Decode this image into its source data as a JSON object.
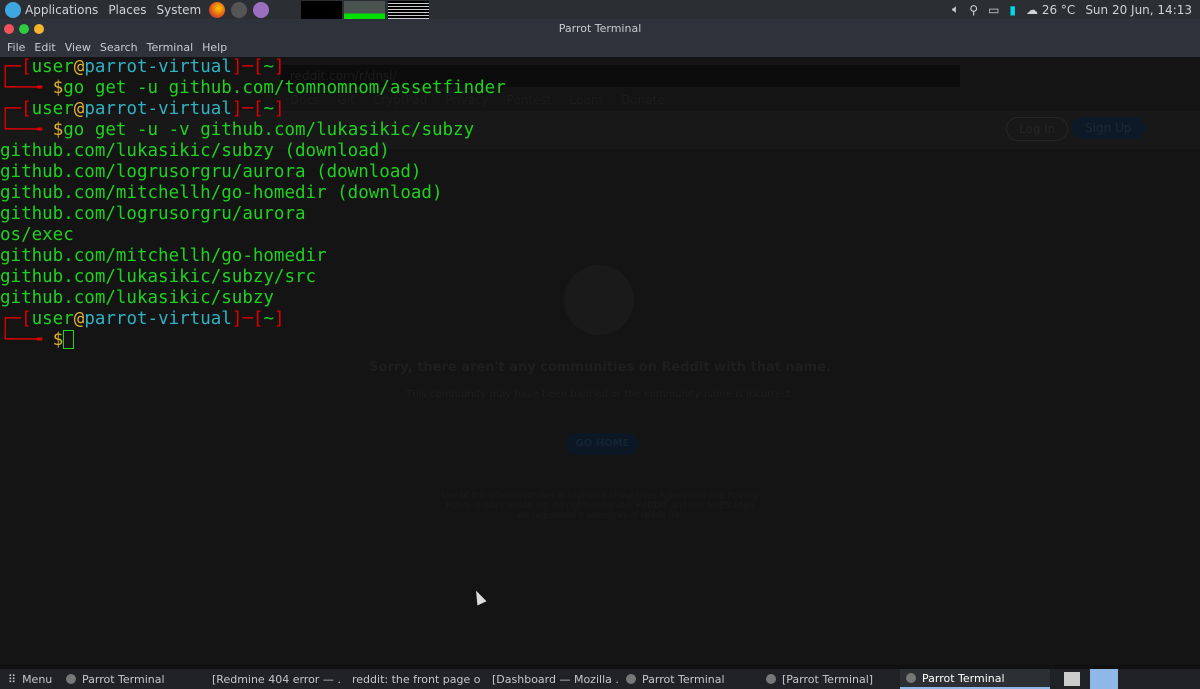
{
  "top_panel": {
    "menus": [
      "Applications",
      "Places",
      "System"
    ],
    "temperature": "26 °C",
    "clock": "Sun 20 Jun, 14:13"
  },
  "window": {
    "title": "Parrot Terminal",
    "menu": [
      "File",
      "Edit",
      "View",
      "Search",
      "Terminal",
      "Help"
    ]
  },
  "background_browser": {
    "url": "reddit.com/r/dnsl/",
    "bookmarks": [
      "Docs",
      "Git",
      "CryptPad",
      "Privacy",
      "Pentest",
      "Learn",
      "Donate"
    ],
    "login": "Log In",
    "signup": "Sign Up",
    "heading": "Sorry, there aren't any communities on Reddit with that name.",
    "subheading": "This community may have been banned or the community name is incorrect.",
    "go_home": "GO HOME",
    "footer": "Use of this site constitutes acceptance of our User Agreement and Privacy Policy. ©2021 reddit inc. All rights reserved. REDDIT and the ALIEN Logo are registered trademarks of reddit inc."
  },
  "terminal": {
    "user": "user",
    "host": "parrot-virtual",
    "dir": "~",
    "commands": [
      "go get -u github.com/tomnomnom/assetfinder",
      "go get -u -v github.com/lukasikic/subzy"
    ],
    "output": [
      "github.com/lukasikic/subzy (download)",
      "github.com/logrusorgru/aurora (download)",
      "github.com/mitchellh/go-homedir (download)",
      "github.com/logrusorgru/aurora",
      "os/exec",
      "github.com/mitchellh/go-homedir",
      "github.com/lukasikic/subzy/src",
      "github.com/lukasikic/subzy"
    ]
  },
  "taskbar": {
    "menu": "Menu",
    "tasks": [
      {
        "label": "Parrot Terminal",
        "icon": "terminal"
      },
      {
        "label": "[Redmine 404 error — ...",
        "icon": "firefox"
      },
      {
        "label": "reddit: the front page of ...",
        "icon": "firefox"
      },
      {
        "label": "[Dashboard — Mozilla ...",
        "icon": "firefox"
      },
      {
        "label": "Parrot Terminal",
        "icon": "terminal"
      },
      {
        "label": "[Parrot Terminal]",
        "icon": "terminal"
      },
      {
        "label": "Parrot Terminal",
        "icon": "terminal",
        "active": true
      }
    ]
  },
  "colors": {
    "prompt_bracket": "#dd0000",
    "prompt_name": "#2fb3c4",
    "prompt_at": "#e2b12e",
    "output": "#1fd21f"
  }
}
